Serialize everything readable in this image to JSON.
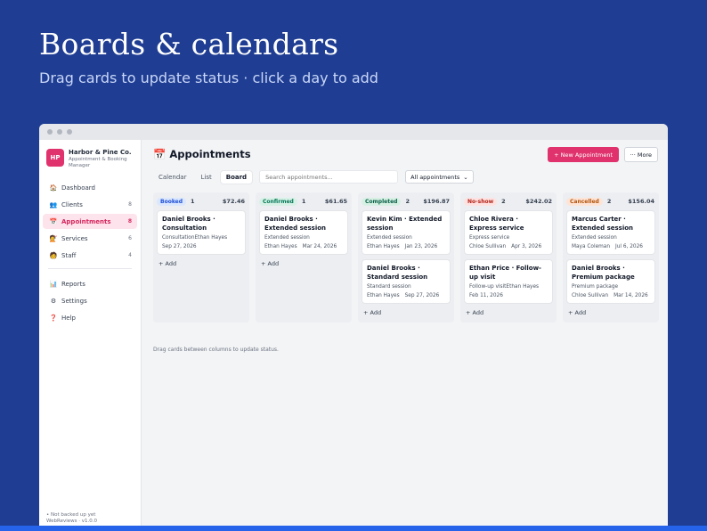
{
  "hero": {
    "title": "Boards & calendars",
    "subtitle": "Drag cards to update status · click a day to add"
  },
  "brand": {
    "logo": "HP",
    "name": "Harbor & Pine Co.",
    "tagline": "Appointment & Booking Manager"
  },
  "sidebar": {
    "items": [
      {
        "label": "Dashboard",
        "icon": "🏠",
        "count": ""
      },
      {
        "label": "Clients",
        "icon": "👥",
        "count": "8"
      },
      {
        "label": "Appointments",
        "icon": "📅",
        "count": "8"
      },
      {
        "label": "Services",
        "icon": "💇",
        "count": "6"
      },
      {
        "label": "Staff",
        "icon": "🧑",
        "count": "4"
      }
    ],
    "secondary": [
      {
        "label": "Reports",
        "icon": "📊"
      },
      {
        "label": "Settings",
        "icon": "⚙"
      },
      {
        "label": "Help",
        "icon": "❓"
      }
    ],
    "footer": "• Not backed up yet",
    "footer2": "WebReviews · v1.0.0"
  },
  "header": {
    "title": "Appointments",
    "title_icon": "📅",
    "new_button": "+ New Appointment",
    "more_button": "··· More"
  },
  "toolbar": {
    "tabs": [
      "Calendar",
      "List",
      "Board"
    ],
    "search_placeholder": "Search appointments...",
    "filter_value": "All appointments",
    "filter_caret": "⌄"
  },
  "board": {
    "columns": [
      {
        "status": "Booked",
        "count": "1",
        "total": "$72.46",
        "pill_bg": "#dbe7fd",
        "pill_fg": "#1d4ed8",
        "cards": [
          {
            "title": "Daniel Brooks · Consultation",
            "service": "",
            "meta": [
              "Consultation",
              "Ethan Hayes"
            ],
            "date": "Sep 27, 2026"
          }
        ]
      },
      {
        "status": "Confirmed",
        "count": "1",
        "total": "$61.65",
        "pill_bg": "#d8f1e6",
        "pill_fg": "#047857",
        "cards": [
          {
            "title": "Daniel Brooks · Extended session",
            "service": "Extended session",
            "meta": [
              "Ethan Hayes",
              "Mar 24, 2026"
            ],
            "date": ""
          }
        ]
      },
      {
        "status": "Completed",
        "count": "2",
        "total": "$196.87",
        "pill_bg": "#d7f0e4",
        "pill_fg": "#065f46",
        "cards": [
          {
            "title": "Kevin Kim · Extended session",
            "service": "Extended session",
            "meta": [
              "Ethan Hayes",
              "Jan 23, 2026"
            ],
            "date": ""
          },
          {
            "title": "Daniel Brooks · Standard session",
            "service": "Standard session",
            "meta": [
              "Ethan Hayes",
              "Sep 27, 2026"
            ],
            "date": ""
          }
        ]
      },
      {
        "status": "No-show",
        "count": "2",
        "total": "$242.02",
        "pill_bg": "#fde2e1",
        "pill_fg": "#b42318",
        "cards": [
          {
            "title": "Chloe Rivera · Express service",
            "service": "Express service",
            "meta": [
              "Chloe Sullivan",
              "Apr 3, 2026"
            ],
            "date": ""
          },
          {
            "title": "Ethan Price · Follow-up visit",
            "service": "",
            "meta": [
              "Follow-up visit",
              "Ethan Hayes"
            ],
            "date": "Feb 11, 2026"
          }
        ]
      },
      {
        "status": "Cancelled",
        "count": "2",
        "total": "$156.04",
        "pill_bg": "#fde4d6",
        "pill_fg": "#b45309",
        "cards": [
          {
            "title": "Marcus Carter · Extended session",
            "service": "Extended session",
            "meta": [
              "Maya Coleman",
              "Jul 6, 2026"
            ],
            "date": ""
          },
          {
            "title": "Daniel Brooks · Premium package",
            "service": "Premium package",
            "meta": [
              "Chloe Sullivan",
              "Mar 14, 2026"
            ],
            "date": ""
          }
        ]
      }
    ],
    "add_label": "+ Add",
    "hint": "Drag cards between columns to update status."
  }
}
